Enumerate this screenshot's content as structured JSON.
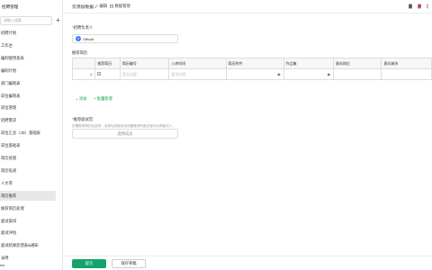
{
  "sidebar": {
    "title": "招聘管理",
    "search_placeholder": "请输入搜索",
    "add_label": "+",
    "items": [
      {
        "label": "招聘计划",
        "active": false
      },
      {
        "label": "工作台",
        "active": false
      },
      {
        "label": "编制使用查表",
        "active": false
      },
      {
        "label": "编制计划",
        "active": false
      },
      {
        "label": "部门编制表",
        "active": false
      },
      {
        "label": "岗位编制表",
        "active": false
      },
      {
        "label": "岗位管理",
        "active": false
      },
      {
        "label": "招聘需求",
        "active": false
      },
      {
        "label": "岗位汇总（JD）基础表",
        "active": false
      },
      {
        "label": "岗位基础表",
        "active": false
      },
      {
        "label": "简历处理",
        "active": false
      },
      {
        "label": "简历投递",
        "active": false
      },
      {
        "label": "人才库",
        "active": false
      },
      {
        "label": "简历推荐",
        "active": true
      },
      {
        "label": "推荐简历处理",
        "active": false
      },
      {
        "label": "面试安排",
        "active": false
      },
      {
        "label": "面试评估",
        "active": false
      },
      {
        "label": "面试结果反馈表&通知",
        "active": false
      },
      {
        "label": "录用",
        "active": false
      }
    ],
    "footer": "ins"
  },
  "topbar": {
    "title": "仅添加数据",
    "edit_label": "编辑",
    "manage_label": "数据管理"
  },
  "form": {
    "owner_label": "招聘负责人",
    "owner_value": "Official",
    "resumes_label": "推荐简历",
    "table": {
      "columns": [
        "推荐简历",
        "简历编号",
        "入库时间",
        "简历附件",
        "作品集",
        "意向岗位",
        "意向城市"
      ],
      "row": {
        "num": "1",
        "code_placeholder": "暂无内容",
        "time_placeholder": "暂无内容"
      }
    },
    "add_label": "添加",
    "batch_add_label": "+ 批量新增",
    "recommend_label": "推荐面试官",
    "recommend_hint": "仅需推荐简历后选择，选择后将被系统设置推荐的面试官作为其面试人。",
    "recommend_placeholder": "选择成员"
  },
  "footer": {
    "submit_label": "提交",
    "save_draft_label": "保存草稿"
  },
  "colors": {
    "primary": "#15a36b",
    "accent_add": "#16a34a",
    "required": "#e53935",
    "avatar": "#3b82f6"
  }
}
